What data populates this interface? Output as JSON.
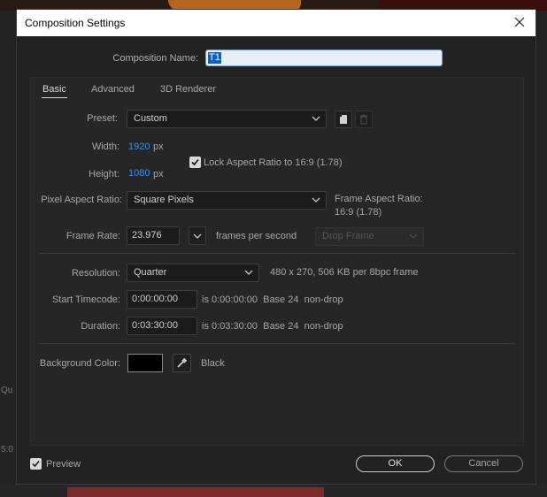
{
  "dialog": {
    "title": "Composition Settings",
    "comp_name_label": "Composition Name:",
    "comp_name_value": "T1"
  },
  "tabs": [
    {
      "label": "Basic",
      "active": true
    },
    {
      "label": "Advanced",
      "active": false
    },
    {
      "label": "3D Renderer",
      "active": false
    }
  ],
  "preset": {
    "label": "Preset:",
    "value": "Custom"
  },
  "width": {
    "label": "Width:",
    "value": "1920",
    "unit": "px"
  },
  "height": {
    "label": "Height:",
    "value": "1080",
    "unit": "px"
  },
  "lock_aspect": {
    "label": "Lock Aspect Ratio to 16:9 (1.78)",
    "checked": true
  },
  "pixel_aspect": {
    "label": "Pixel Aspect Ratio:",
    "value": "Square Pixels"
  },
  "frame_aspect": {
    "label": "Frame Aspect Ratio:",
    "value": "16:9 (1.78)"
  },
  "frame_rate": {
    "label": "Frame Rate:",
    "value": "23.976",
    "unit": "frames per second",
    "drop_frame": "Drop Frame"
  },
  "resolution": {
    "label": "Resolution:",
    "value": "Quarter",
    "info": "480 x 270, 506 KB per 8bpc frame"
  },
  "start_timecode": {
    "label": "Start Timecode:",
    "value": "0:00:00:00",
    "info": "is 0:00:00:00  Base 24  non-drop"
  },
  "duration": {
    "label": "Duration:",
    "value": "0:03:30:00",
    "info": "is 0:03:30:00  Base 24  non-drop"
  },
  "background": {
    "label": "Background Color:",
    "color": "#000000",
    "name": "Black"
  },
  "footer": {
    "preview_label": "Preview",
    "preview_checked": true,
    "ok_label": "OK",
    "cancel_label": "Cancel"
  },
  "background_app": {
    "left_text_1": "Qu",
    "left_text_2": "5:0"
  },
  "icons": [
    "close-icon",
    "chevron-down-icon",
    "save-preset-icon",
    "trash-icon",
    "checkmark-icon",
    "eyedropper-icon"
  ]
}
